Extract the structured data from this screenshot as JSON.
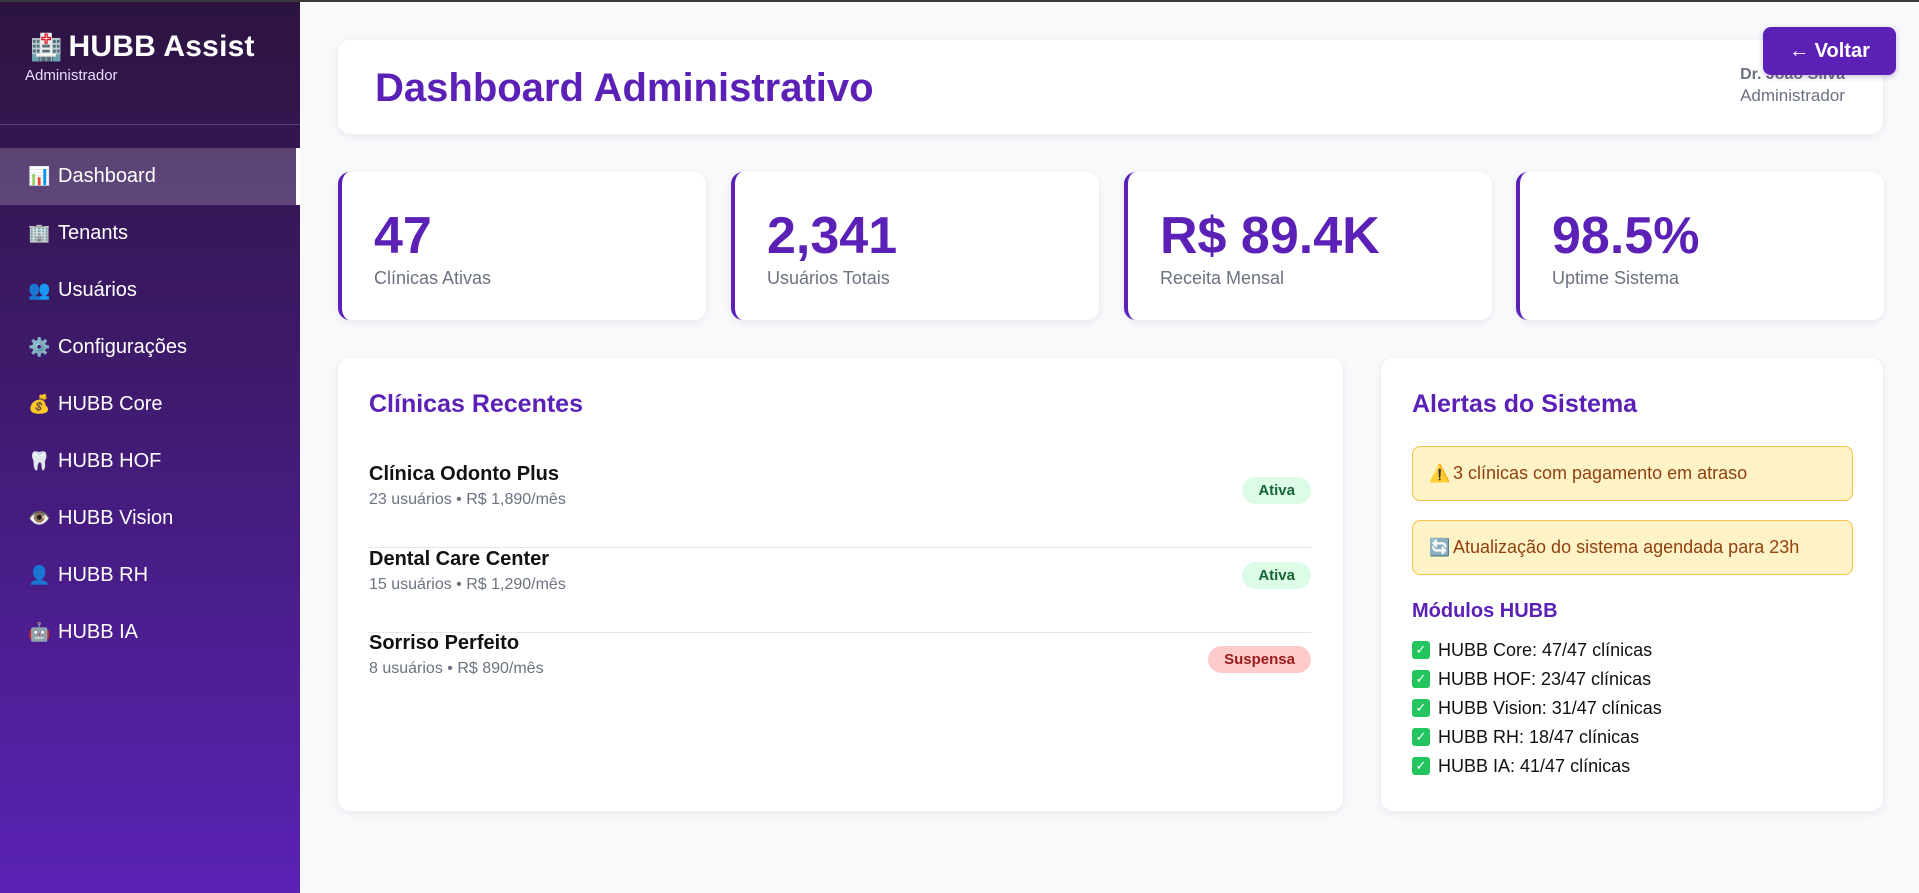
{
  "sidebar": {
    "brand_icon": "🏥",
    "brand_title": "HUBB Assist",
    "brand_subtitle": "Administrador",
    "items": [
      {
        "icon": "📊",
        "label": "Dashboard"
      },
      {
        "icon": "🏢",
        "label": "Tenants"
      },
      {
        "icon": "👥",
        "label": "Usuários"
      },
      {
        "icon": "⚙️",
        "label": "Configurações"
      },
      {
        "icon": "💰",
        "label": "HUBB Core"
      },
      {
        "icon": "🦷",
        "label": "HUBB HOF"
      },
      {
        "icon": "👁️",
        "label": "HUBB Vision"
      },
      {
        "icon": "👤",
        "label": "HUBB RH"
      },
      {
        "icon": "🤖",
        "label": "HUBB IA"
      }
    ],
    "active_index": 0
  },
  "header": {
    "title": "Dashboard Administrativo",
    "user_name": "Dr. João Silva",
    "user_role": "Administrador",
    "back_label": "← Voltar"
  },
  "stats": [
    {
      "value": "47",
      "label": "Clínicas Ativas"
    },
    {
      "value": "2,341",
      "label": "Usuários Totais"
    },
    {
      "value": "R$ 89.4K",
      "label": "Receita Mensal"
    },
    {
      "value": "98.5%",
      "label": "Uptime Sistema"
    }
  ],
  "recent_clinics": {
    "title": "Clínicas Recentes",
    "rows": [
      {
        "name": "Clínica Odonto Plus",
        "meta": "23 usuários • R$ 1,890/mês",
        "status": "Ativa"
      },
      {
        "name": "Dental Care Center",
        "meta": "15 usuários • R$ 1,290/mês",
        "status": "Ativa"
      },
      {
        "name": "Sorriso Perfeito",
        "meta": "8 usuários • R$ 890/mês",
        "status": "Suspensa"
      }
    ]
  },
  "alerts": {
    "title": "Alertas do Sistema",
    "items": [
      {
        "icon": "⚠️",
        "text": "3 clínicas com pagamento em atraso"
      },
      {
        "icon": "🔄",
        "text": "Atualização do sistema agendada para 23h"
      }
    ],
    "modules_title": "Módulos HUBB",
    "modules": [
      "HUBB Core: 47/47 clínicas",
      "HUBB HOF: 23/47 clínicas",
      "HUBB Vision: 31/47 clínicas",
      "HUBB RH: 18/47 clínicas",
      "HUBB IA: 41/47 clínicas"
    ]
  },
  "colors": {
    "accent": "#5b21b6",
    "sidebar_top": "#2c1440",
    "sidebar_bottom": "#5a22b5",
    "badge_active_bg": "#dcfce7",
    "badge_suspended_bg": "#fecaca",
    "alert_bg": "#fef3c7"
  }
}
